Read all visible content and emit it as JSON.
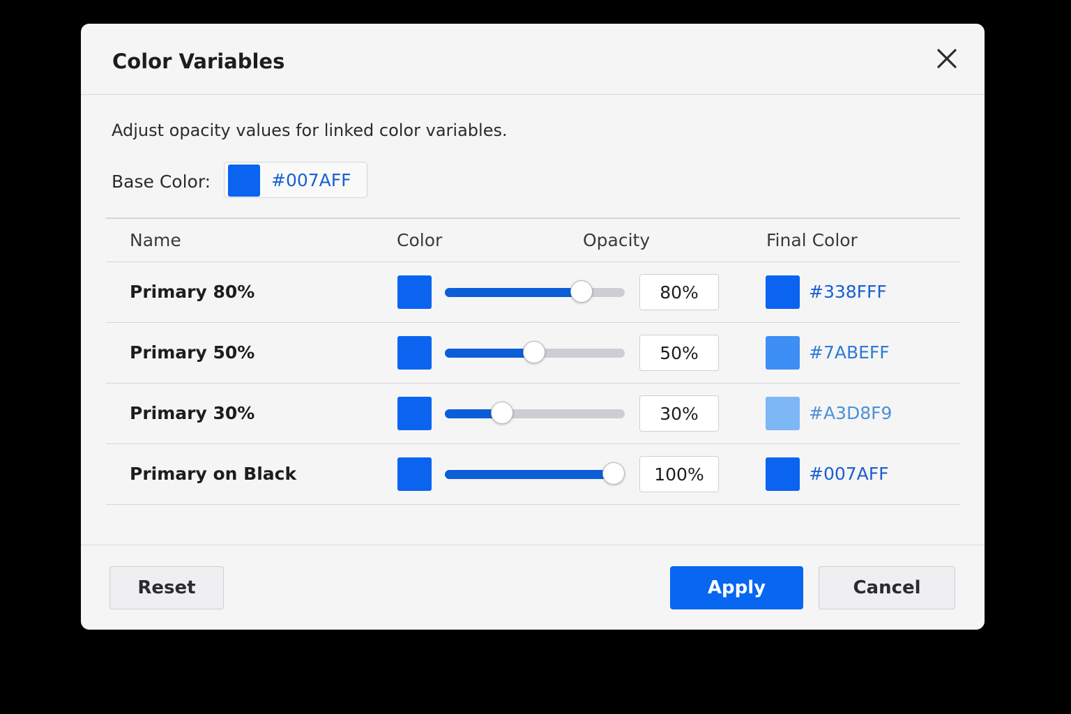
{
  "dialog": {
    "title": "Color Variables",
    "close_icon": "close-icon",
    "description": "Adjust opacity values for linked color variables.",
    "base_color": {
      "label": "Base Color:",
      "hex": "#007AFF",
      "swatch_color": "#0A64F0"
    },
    "table": {
      "headers": {
        "name": "Name",
        "color": "Color",
        "opacity": "Opacity",
        "final_color": "Final Color"
      },
      "rows": [
        {
          "name": "Primary 80%",
          "color_swatch": "#0A64F0",
          "opacity_fraction": 0.8,
          "opacity_text": "80%",
          "final_swatch": "#0A64F0",
          "final_hex": "#338FFF",
          "final_hex_color": "#1a5fd0"
        },
        {
          "name": "Primary 50%",
          "color_swatch": "#0A64F0",
          "opacity_fraction": 0.5,
          "opacity_text": "50%",
          "final_swatch": "#3D8EF5",
          "final_hex": "#7ABEFF",
          "final_hex_color": "#2f7ad6"
        },
        {
          "name": "Primary 30%",
          "color_swatch": "#0A64F0",
          "opacity_fraction": 0.3,
          "opacity_text": "30%",
          "final_swatch": "#7DB7F6",
          "final_hex": "#A3D8F9",
          "final_hex_color": "#4d8fd9"
        },
        {
          "name": "Primary on Black",
          "color_swatch": "#0A64F0",
          "opacity_fraction": 1.0,
          "opacity_text": "100%",
          "final_swatch": "#0A64F0",
          "final_hex": "#007AFF",
          "final_hex_color": "#1a5fd0"
        }
      ]
    },
    "footer": {
      "reset_label": "Reset",
      "apply_label": "Apply",
      "cancel_label": "Cancel"
    },
    "colors": {
      "accent": "#0866F0",
      "slider_fill": "#0B5ED8",
      "slider_track": "#CDCED3"
    }
  }
}
